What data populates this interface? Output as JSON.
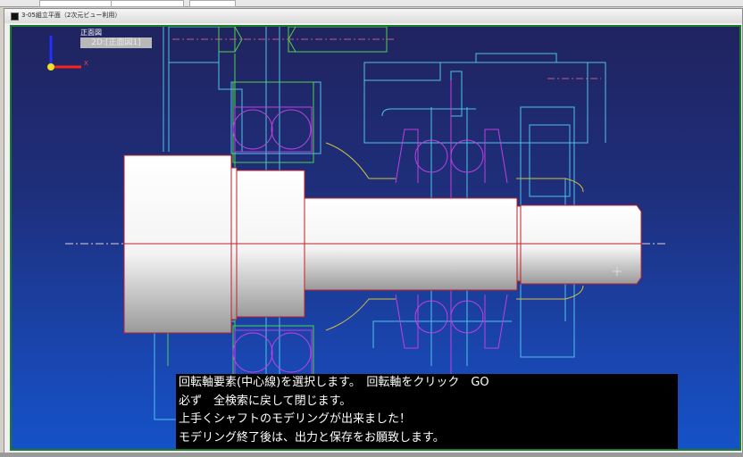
{
  "window": {
    "title": "3-05組立平面（2次元ビュー利用）"
  },
  "view": {
    "label": "正面図",
    "name": "2D:[正面図1]",
    "axis_x": "X"
  },
  "messages": [
    "回転軸要素(中心線)を選択します。　回転軸をクリック　GO",
    "必ず　全検索に戻して閉じます。",
    "上手くシャフトのモデリングが出来ました！",
    "モデリング終了後は、出力と保存をお願致します。"
  ],
  "colors": {
    "viewport_border": "#1d7a2a",
    "centerline": "#c0202a",
    "drawing_cyan": "#4fc3e8",
    "drawing_magenta": "#c040e0",
    "drawing_green": "#50d050"
  }
}
